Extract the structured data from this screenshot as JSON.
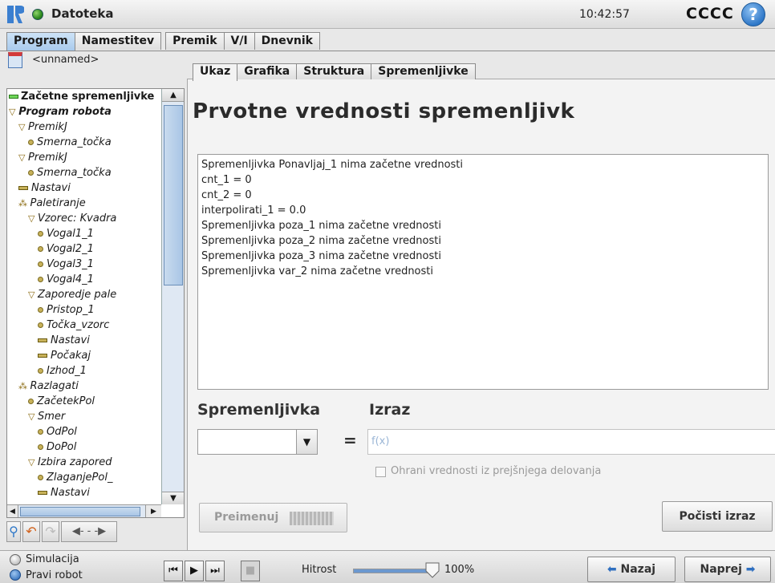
{
  "header": {
    "app_title": "Datoteka",
    "clock": "10:42:57",
    "robot_name": "CCCC",
    "help_symbol": "?"
  },
  "main_tabs": [
    "Program",
    "Namestitev",
    "Premik",
    "V/I",
    "Dnevnik"
  ],
  "program": {
    "name": "<unnamed>"
  },
  "tree": {
    "items": [
      {
        "label": "Začetne spremenljivke",
        "marker": "green-bar",
        "indent": 0,
        "bold": true
      },
      {
        "label": "Program robota",
        "marker": "triangle",
        "indent": 0,
        "bold": true
      },
      {
        "label": "PremikJ",
        "marker": "triangle",
        "indent": 1
      },
      {
        "label": "Smerna_točka",
        "marker": "dot",
        "indent": 2
      },
      {
        "label": "PremikJ",
        "marker": "triangle",
        "indent": 1
      },
      {
        "label": "Smerna_točka",
        "marker": "dot",
        "indent": 2
      },
      {
        "label": "Nastavi",
        "marker": "bar",
        "indent": 1
      },
      {
        "label": "Paletiranje",
        "marker": "pallet",
        "indent": 1
      },
      {
        "label": "Vzorec: Kvadra",
        "marker": "triangle",
        "indent": 2
      },
      {
        "label": "Vogal1_1",
        "marker": "dot",
        "indent": 3
      },
      {
        "label": "Vogal2_1",
        "marker": "dot",
        "indent": 3
      },
      {
        "label": "Vogal3_1",
        "marker": "dot",
        "indent": 3
      },
      {
        "label": "Vogal4_1",
        "marker": "dot",
        "indent": 3
      },
      {
        "label": "Zaporedje pale",
        "marker": "triangle",
        "indent": 2
      },
      {
        "label": "Pristop_1",
        "marker": "dot",
        "indent": 3
      },
      {
        "label": "Točka_vzorc",
        "marker": "dot",
        "indent": 3
      },
      {
        "label": "Nastavi",
        "marker": "bar",
        "indent": 3
      },
      {
        "label": "Počakaj",
        "marker": "bar",
        "indent": 3
      },
      {
        "label": "Izhod_1",
        "marker": "dot",
        "indent": 3
      },
      {
        "label": "Razlagati",
        "marker": "pallet",
        "indent": 1
      },
      {
        "label": "ZačetekPol",
        "marker": "dot",
        "indent": 2
      },
      {
        "label": "Smer",
        "marker": "triangle",
        "indent": 2
      },
      {
        "label": "OdPol",
        "marker": "dot",
        "indent": 3
      },
      {
        "label": "DoPol",
        "marker": "dot",
        "indent": 3
      },
      {
        "label": "Izbira zapored",
        "marker": "triangle",
        "indent": 2
      },
      {
        "label": "ZlaganjePol_",
        "marker": "dot",
        "indent": 3
      },
      {
        "label": "Nastavi",
        "marker": "bar",
        "indent": 3
      }
    ]
  },
  "sub_tabs": [
    "Ukaz",
    "Grafika",
    "Struktura",
    "Spremenljivke"
  ],
  "panel": {
    "title": "Prvotne vrednosti spremenljivk",
    "variables": [
      "Spremenljivka Ponavljaj_1 nima začetne vrednosti",
      "cnt_1 = 0",
      "cnt_2 = 0",
      "interpolirati_1 = 0.0",
      "Spremenljivka poza_1 nima začetne vrednosti",
      "Spremenljivka poza_2 nima začetne vrednosti",
      "Spremenljivka poza_3 nima začetne vrednosti",
      "Spremenljivka var_2 nima začetne vrednosti"
    ],
    "var_label": "Spremenljivka",
    "expr_label": "Izraz",
    "equals": "=",
    "expr_placeholder": "f(x)",
    "keep_label": "Ohrani vrednosti iz prejšnjega delovanja",
    "rename_label": "Preimenuj",
    "clear_label": "Počisti izraz"
  },
  "footer": {
    "sim_label": "Simulacija",
    "real_label": "Pravi robot",
    "speed_label": "Hitrost",
    "speed_value": "100%",
    "speed_fraction": 1.0,
    "back_label": "Nazaj",
    "next_label": "Naprej"
  },
  "colors": {
    "accent_blue": "#2f78c8",
    "active_tab": "#a7c9ec",
    "status_green": "#2e8b1f"
  }
}
